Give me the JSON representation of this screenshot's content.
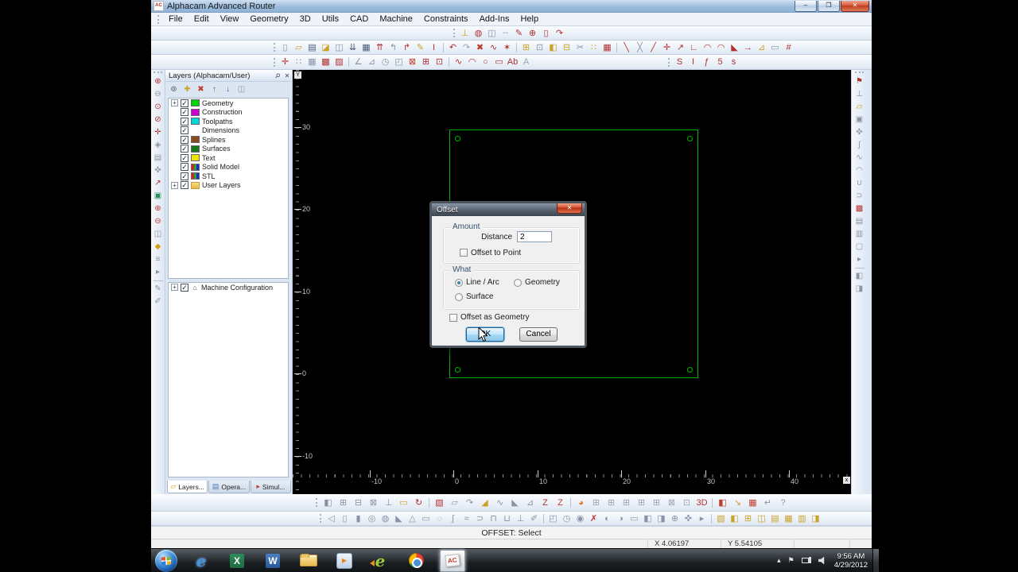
{
  "window": {
    "title": "Alphacam Advanced Router",
    "app_icon_text": "AC",
    "controls": [
      {
        "name": "minimize",
        "glyph": "–"
      },
      {
        "name": "maximize",
        "glyph": "❐"
      },
      {
        "name": "close",
        "glyph": "✕"
      }
    ]
  },
  "menu": {
    "items": [
      "File",
      "Edit",
      "View",
      "Geometry",
      "3D",
      "Utils",
      "CAD",
      "Machine",
      "Constraints",
      "Add-Ins",
      "Help"
    ]
  },
  "toolbars": {
    "quick": [
      [
        "layer-gauge",
        "⊥",
        "#c9a227"
      ],
      [
        "hatch-circle",
        "◍",
        "#b03030"
      ],
      [
        "copy-pages",
        "◫",
        "#8a93a6"
      ],
      [
        "dashed-line",
        "┄",
        "#8a93a6"
      ],
      [
        "sketch-pencil",
        "✎",
        "#b03030"
      ],
      [
        "zoom-area",
        "⊕",
        "#b03030"
      ],
      [
        "sheet-bounds",
        "▯",
        "#b03030"
      ],
      [
        "pan-view",
        "↷",
        "#b03030"
      ]
    ],
    "row2": [
      [
        "new-file",
        "▯",
        "#8a93a6"
      ],
      [
        "open-file",
        "▱",
        "#c9a227"
      ],
      [
        "save-file",
        "▤",
        "#4a5a7a"
      ],
      [
        "open-drawing",
        "◪",
        "#c9a227"
      ],
      [
        "copy-drawing",
        "◫",
        "#8a93a6"
      ],
      [
        "import-file",
        "⇊",
        "#4a5a7a"
      ],
      [
        "print",
        "▦",
        "#4a5a7a"
      ],
      [
        "export-file",
        "⇈",
        "#b03030"
      ],
      [
        "send-left",
        "↰",
        "#8a93a6"
      ],
      [
        "send-right",
        "↱",
        "#b03030"
      ],
      [
        "highlighter",
        "✎",
        "#c9a227"
      ],
      [
        "insert-marker",
        "I",
        "#b03030"
      ],
      "sep",
      [
        "undo",
        "↶",
        "#b03030"
      ],
      [
        "redo",
        "↷",
        "#9aa4b5"
      ],
      [
        "delete",
        "✖",
        "#c03a2b"
      ],
      [
        "join-node",
        "∿",
        "#b03030"
      ],
      [
        "explode",
        "✶",
        "#b03030"
      ],
      "sep",
      [
        "paste-transform",
        "⊞",
        "#c9a227"
      ],
      [
        "node-edit",
        "⊡",
        "#8a93a6"
      ],
      [
        "fill-edit",
        "◧",
        "#c9a227"
      ],
      [
        "offset-copy",
        "⊟",
        "#c9a227"
      ],
      [
        "trim",
        "✂",
        "#8a93a6"
      ],
      [
        "array-copy",
        "∷",
        "#c9a227"
      ],
      [
        "pattern-grid",
        "▦",
        "#b03030"
      ],
      "sep",
      [
        "break-line",
        "╲",
        "#b03030"
      ],
      [
        "break-cross",
        "╳",
        "#8a93a6"
      ],
      [
        "line-divide",
        "╱",
        "#b03030"
      ],
      [
        "trim-intersect",
        "✛",
        "#b03030"
      ],
      [
        "extend-line",
        "↗",
        "#b03030"
      ],
      [
        "corner-snap",
        "∟",
        "#b03030"
      ],
      [
        "fillet-arc",
        "◠",
        "#b03030"
      ],
      [
        "fillet-corner",
        "◠",
        "#c03a2b"
      ],
      [
        "chamfer",
        "◣",
        "#b03030"
      ],
      [
        "arrow-select",
        "→",
        "#b03030"
      ],
      [
        "angle-box",
        "⊿",
        "#c9a227"
      ],
      [
        "dim-measure",
        "▭",
        "#8a93a6"
      ],
      [
        "measure-123",
        "#",
        "#b03030"
      ]
    ],
    "row3a": [
      [
        "move-items",
        "✛",
        "#b03030"
      ],
      [
        "snap-grid",
        "∷",
        "#8a93a6"
      ],
      [
        "grid-settings",
        "▦",
        "#8a93a6"
      ],
      [
        "cam-select",
        "▩",
        "#b03030"
      ],
      [
        "cam-window",
        "▨",
        "#b03030"
      ],
      "sep",
      [
        "angle-measure",
        "∠",
        "#8a93a6"
      ],
      [
        "set-square",
        "⊿",
        "#8a93a6"
      ],
      [
        "compass",
        "◷",
        "#8a93a6"
      ],
      [
        "sheet-transform",
        "◰",
        "#8a93a6"
      ],
      [
        "delete-sheet",
        "⊠",
        "#c03a2b"
      ],
      [
        "add-sheet",
        "⊞",
        "#b03030"
      ],
      [
        "goto-sheet",
        "⊡",
        "#b03030"
      ],
      "sep",
      [
        "polyline",
        "∿",
        "#b03030"
      ],
      [
        "arc",
        "◠",
        "#b03030"
      ],
      [
        "circle",
        "○",
        "#b03030"
      ],
      [
        "rectangle",
        "▭",
        "#b03030"
      ],
      [
        "text-ab",
        "Ab",
        "#b03030"
      ],
      [
        "text-styles",
        "A",
        "#9aa4b5"
      ]
    ],
    "row3b": [
      [
        "spline-curve",
        "S",
        "#b03030"
      ],
      [
        "i-beam",
        "I",
        "#b03030"
      ],
      [
        "function-curve",
        "ƒ",
        "#b03030"
      ],
      [
        "curve-tools",
        "5",
        "#b03030"
      ],
      [
        "reverse-curve",
        "s",
        "#b03030"
      ]
    ],
    "left": [
      [
        "zoom-window",
        "⊕",
        "#b03030"
      ],
      [
        "zoom-previous",
        "⊖",
        "#8a93a6"
      ],
      [
        "zoom-all",
        "⊙",
        "#b03030"
      ],
      [
        "zoom-material",
        "⊘",
        "#b03030"
      ],
      [
        "pan",
        "✛",
        "#b03030"
      ],
      [
        "view-3d",
        "◈",
        "#8a93a6"
      ],
      [
        "view-iso",
        "▤",
        "#8a93a6"
      ],
      [
        "view-rotate",
        "✜",
        "#8a93a6"
      ],
      [
        "measure",
        "↗",
        "#b03030"
      ],
      [
        "render-view",
        "▣",
        "#2e8b57"
      ],
      [
        "zoom-in",
        "⊕",
        "#c03a2b"
      ],
      [
        "zoom-out",
        "⊖",
        "#c03a2b"
      ],
      [
        "sheet-views",
        "◫",
        "#8a93a6"
      ],
      [
        "material-cube",
        "◆",
        "#d4a017"
      ],
      [
        "layer-list",
        "≡",
        "#8a93a6"
      ],
      [
        "expand-strip",
        "▸",
        "#8a93a6"
      ],
      "sep",
      [
        "draw-pen",
        "✎",
        "#8a93a6"
      ],
      [
        "draw-brush",
        "✐",
        "#8a93a6"
      ]
    ],
    "right": [
      [
        "flag-marker",
        "⚑",
        "#b03030"
      ],
      [
        "drill-tool",
        "⊥",
        "#8a93a6"
      ],
      [
        "tool-folder",
        "▱",
        "#c9a227"
      ],
      [
        "snapshot",
        "▣",
        "#8a93a6"
      ],
      [
        "grab-hand",
        "✜",
        "#8a93a6"
      ],
      [
        "lead-in",
        "∫",
        "#8a93a6"
      ],
      [
        "contour",
        "∿",
        "#8a93a6"
      ],
      [
        "arc-move",
        "◠",
        "#8a93a6"
      ],
      [
        "pocket",
        "∪",
        "#8a93a6"
      ],
      [
        "profile",
        "⊃",
        "#8a93a6"
      ],
      [
        "simulate",
        "▩",
        "#b03030"
      ],
      [
        "op-list",
        "▤",
        "#8a93a6"
      ],
      [
        "tool-list",
        "▥",
        "#8a93a6"
      ],
      [
        "nc-doc",
        "▢",
        "#8a93a6"
      ],
      [
        "expand-right",
        "▸",
        "#8a93a6"
      ],
      "sep",
      [
        "cam-left",
        "◧",
        "#8a93a6"
      ],
      [
        "cam-right",
        "◨",
        "#8a93a6"
      ]
    ],
    "bottom1": [
      [
        "extrude",
        "◧",
        "#8a93a6"
      ],
      [
        "solid-box",
        "⊞",
        "#8a93a6"
      ],
      [
        "solid-subtract",
        "⊟",
        "#8a93a6"
      ],
      [
        "solid-intersect",
        "⊠",
        "#8a93a6"
      ],
      [
        "axis-pin",
        "⊥",
        "#8a93a6"
      ],
      [
        "face-select",
        "▭",
        "#c9a227"
      ],
      [
        "orbit",
        "↻",
        "#b03030"
      ],
      "sep",
      [
        "surface-patch",
        "▧",
        "#b03030"
      ],
      [
        "surface-erase",
        "▱",
        "#8a93a6"
      ],
      [
        "sweep",
        "↷",
        "#8a93a6"
      ],
      [
        "ramp-face",
        "◢",
        "#c9a227"
      ],
      [
        "wave-surface",
        "∿",
        "#8a93a6"
      ],
      [
        "cone-surface",
        "◣",
        "#8a93a6"
      ],
      [
        "draft-angle",
        "⊿",
        "#8a93a6"
      ],
      [
        "z-contour",
        "Z",
        "#b03030"
      ],
      [
        "z-level",
        "Z",
        "#c03a2b"
      ],
      "sep",
      [
        "ortho-wedge",
        "◕",
        "#e07820"
      ],
      [
        "mesh-front",
        "⊞",
        "#9aa4b5"
      ],
      [
        "mesh-top",
        "⊞",
        "#9aa4b5"
      ],
      [
        "mesh-side",
        "⊞",
        "#9aa4b5"
      ],
      [
        "mesh-iso",
        "⊞",
        "#9aa4b5"
      ],
      [
        "mesh-back",
        "⊞",
        "#9aa4b5"
      ],
      [
        "mesh-cut",
        "⊠",
        "#9aa4b5"
      ],
      [
        "mesh-box",
        "⊡",
        "#9aa4b5"
      ],
      [
        "three-d-view",
        "3D",
        "#b03030"
      ],
      "sep",
      [
        "clip-red",
        "◧",
        "#c03a2b"
      ],
      [
        "mark-yellow",
        "↘",
        "#c9a227"
      ],
      [
        "cam-red-box",
        "▦",
        "#c03a2b"
      ],
      [
        "return-op",
        "↵",
        "#8a93a6"
      ],
      [
        "help",
        "?",
        "#8a93a6"
      ]
    ],
    "bottom2": [
      [
        "revolve",
        "◁",
        "#8a93a6"
      ],
      [
        "cylinder",
        "▯",
        "#8a93a6"
      ],
      [
        "solid-cylinder",
        "▮",
        "#8a93a6"
      ],
      [
        "sphere",
        "◎",
        "#8a93a6"
      ],
      [
        "torus",
        "◍",
        "#8a93a6"
      ],
      [
        "corner-solid",
        "◣",
        "#8a93a6"
      ],
      [
        "pyramid",
        "△",
        "#8a93a6"
      ],
      [
        "block",
        "▭",
        "#8a93a6"
      ],
      [
        "shell",
        "◌",
        "#8a93a6"
      ],
      [
        "twist",
        "∫",
        "#8a93a6"
      ],
      [
        "loft",
        "≈",
        "#8a93a6"
      ],
      [
        "pipe",
        "⊃",
        "#8a93a6"
      ],
      [
        "lock-op",
        "⊓",
        "#8a93a6"
      ],
      [
        "cap-op",
        "⊔",
        "#8a93a6"
      ],
      [
        "fastener",
        "⊥",
        "#8a93a6"
      ],
      [
        "spanner",
        "✐",
        "#8a93a6"
      ],
      "sep",
      [
        "view-front",
        "◰",
        "#8a93a6"
      ],
      [
        "view-clock",
        "◷",
        "#8a93a6"
      ],
      [
        "view-target",
        "◉",
        "#8a93a6"
      ],
      [
        "delete-view",
        "✗",
        "#c03a2b"
      ],
      [
        "view-half-left",
        "◐",
        "#8a93a6"
      ],
      [
        "view-half-right",
        "◑",
        "#8a93a6"
      ],
      [
        "view-plane",
        "▭",
        "#8a93a6"
      ],
      [
        "view-left",
        "◧",
        "#8a93a6"
      ],
      [
        "view-right",
        "◨",
        "#8a93a6"
      ],
      [
        "zoom-view",
        "⊕",
        "#8a93a6"
      ],
      [
        "pan-hand",
        "✜",
        "#8a93a6"
      ],
      [
        "next-view",
        "▸",
        "#8a93a6"
      ],
      "sep",
      [
        "ucs-hatch",
        "▧",
        "#c9a227"
      ],
      [
        "ucs-left",
        "◧",
        "#c9a227"
      ],
      [
        "ucs-grid",
        "⊞",
        "#c9a227"
      ],
      [
        "ucs-pair",
        "◫",
        "#c9a227"
      ],
      [
        "ucs-rows",
        "▤",
        "#c9a227"
      ],
      [
        "ucs-mesh",
        "▦",
        "#c9a227"
      ],
      [
        "ucs-cols",
        "▥",
        "#c9a227"
      ],
      [
        "ucs-right",
        "◨",
        "#c9a227"
      ]
    ],
    "layersTools": [
      [
        "find-layer",
        "⊚",
        "#4a5a7a"
      ],
      [
        "new-layer",
        "✚",
        "#c9a227"
      ],
      [
        "delete-layer",
        "✖",
        "#c03a2b"
      ],
      [
        "layer-up",
        "↑",
        "#2a5db0"
      ],
      [
        "layer-down",
        "↓",
        "#2a5db0"
      ],
      [
        "layer-dialog",
        "◫",
        "#8a93a6"
      ]
    ]
  },
  "layersPanel": {
    "title": "Layers (Alphacam/User)",
    "pin_glyph": "⚲",
    "close_glyph": "✕",
    "check_glyph": "✓",
    "expand_glyph": "+",
    "layers": [
      {
        "label": "Geometry",
        "swatch": "#00d400",
        "expand": true,
        "checked": true
      },
      {
        "label": "Construction",
        "swatch": "#cc00cc",
        "checked": true
      },
      {
        "label": "Toolpaths",
        "swatch": "#00d8d8",
        "checked": true
      },
      {
        "label": "Dimensions",
        "swatch": "none",
        "checked": true
      },
      {
        "label": "Splines",
        "swatch": "#8a4a1a",
        "checked": true
      },
      {
        "label": "Surfaces",
        "swatch": "#157a15",
        "checked": true
      },
      {
        "label": "Text",
        "swatch": "#f2e200",
        "checked": true
      },
      {
        "label": "Solid Model",
        "swatch": "stripes",
        "checked": true
      },
      {
        "label": "STL",
        "swatch": "stripes",
        "checked": true
      },
      {
        "label": "User Layers",
        "swatch": "folder",
        "expand": true,
        "checked": true
      }
    ],
    "machine": {
      "label": "Machine Configuration",
      "expand": true,
      "checked": true,
      "icon_glyph": "⌂"
    },
    "tabs": [
      {
        "label": "Layers...",
        "glyph": "▱",
        "color": "#d4a017",
        "active": true
      },
      {
        "label": "Opera...",
        "glyph": "▤",
        "color": "#4a7ab5",
        "active": false
      },
      {
        "label": "Simul...",
        "glyph": "▸",
        "color": "#c0392b",
        "active": false
      }
    ]
  },
  "canvas": {
    "y_axis_letter": "Y",
    "x_axis_letter": "x",
    "x_ticks": [
      -10,
      0,
      10,
      20,
      30,
      40
    ],
    "y_ticks": [
      30,
      20,
      10,
      0,
      -10
    ],
    "geometry_color": "#00b400",
    "shape": "rectangle-with-corner-markers"
  },
  "dialog": {
    "title": "Offset",
    "close_glyph": "✕",
    "amount_group": "Amount",
    "distance_label": "Distance",
    "distance_value": "2",
    "offset_to_point": "Offset to Point",
    "what_group": "What",
    "option_line_arc": "Line / Arc",
    "option_geometry": "Geometry",
    "option_surface": "Surface",
    "offset_as_geometry": "Offset as Geometry",
    "ok_label": "OK",
    "cancel_label": "Cancel"
  },
  "status": {
    "prompt": "OFFSET: Select",
    "x_coord": "X 4.06197",
    "y_coord": "Y 5.54105"
  },
  "taskbar": {
    "apps": [
      {
        "name": "start"
      },
      {
        "name": "internet-explorer",
        "letter": "e"
      },
      {
        "name": "excel",
        "letter": "X"
      },
      {
        "name": "word",
        "letter": "W"
      },
      {
        "name": "explorer"
      },
      {
        "name": "media-player",
        "letter": "▸"
      },
      {
        "name": "green-e",
        "letter": "e"
      },
      {
        "name": "chrome"
      },
      {
        "name": "alphacam",
        "letter": "AC",
        "active": true
      }
    ],
    "tray": [
      {
        "name": "show-hidden",
        "glyph": "▴"
      },
      {
        "name": "action-flag",
        "glyph": "⚑"
      },
      {
        "name": "network"
      },
      {
        "name": "volume"
      }
    ],
    "clock": {
      "time": "9:56 AM",
      "date": "4/29/2012"
    }
  }
}
